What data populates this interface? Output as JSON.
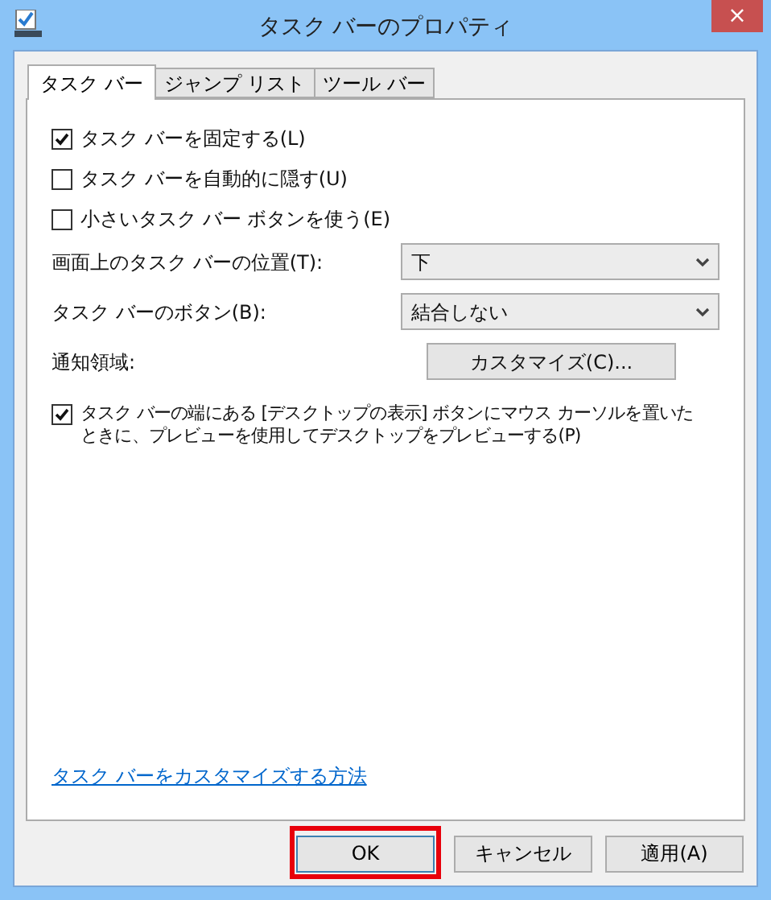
{
  "window": {
    "title": "タスク バーのプロパティ",
    "close": "×"
  },
  "tabs": [
    {
      "label": "タスク バー",
      "selected": true
    },
    {
      "label": "ジャンプ リスト",
      "selected": false
    },
    {
      "label": "ツール バー",
      "selected": false
    }
  ],
  "options": [
    {
      "kind": "checkbox",
      "label": "タスク バーを固定する(L)",
      "checked": true
    },
    {
      "kind": "checkbox",
      "label": "タスク バーを自動的に隠す(U)",
      "checked": false
    },
    {
      "kind": "checkbox",
      "label": "小さいタスク バー ボタンを使う(E)",
      "checked": false
    },
    {
      "kind": "dropdown",
      "label": "画面上のタスク バーの位置(T):",
      "value": "下"
    },
    {
      "kind": "dropdown",
      "label": "タスク バーのボタン(B):",
      "value": "結合しない"
    },
    {
      "kind": "button",
      "label": "通知領域:",
      "value": "カスタマイズ(C)..."
    },
    {
      "kind": "checkbox",
      "label": "タスク バーの端にある [デスクトップの表示] ボタンにマウス カーソルを置いたときに、プレビューを使用してデスクトップをプレビューする(P)",
      "checked": true
    }
  ],
  "link": "タスク バーをカスタマイズする方法",
  "buttons": [
    {
      "label": "OK",
      "highlighted": true
    },
    {
      "label": "キャンセル",
      "highlighted": false
    },
    {
      "label": "適用(A)",
      "highlighted": false
    }
  ]
}
